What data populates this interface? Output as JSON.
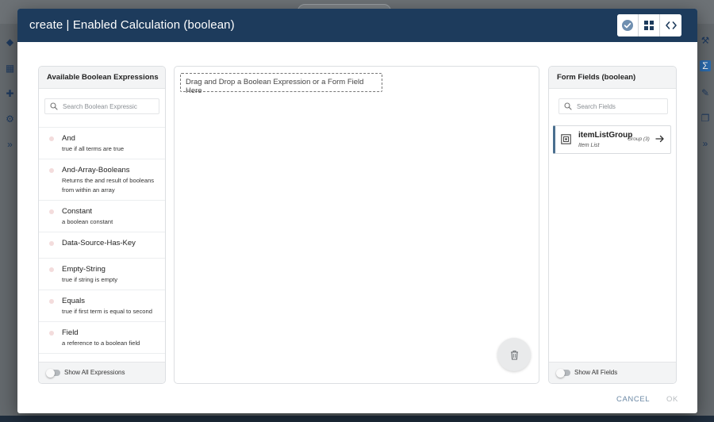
{
  "dialog": {
    "title": "create | Enabled Calculation (boolean)",
    "header_buttons": [
      "check-circle-icon",
      "grid-icon",
      "code-icon"
    ],
    "cancel_label": "CANCEL",
    "ok_label": "OK"
  },
  "left_panel": {
    "title": "Available Boolean Expressions",
    "search_placeholder": "Search Boolean Expressic",
    "expressions": [
      {
        "name": "And",
        "description": "true if all terms are true"
      },
      {
        "name": "And-Array-Booleans",
        "description": "Returns the and result of booleans from within an array"
      },
      {
        "name": "Constant",
        "description": "a boolean constant"
      },
      {
        "name": "Data-Source-Has-Key",
        "description": ""
      },
      {
        "name": "Empty-String",
        "description": "true if string is empty"
      },
      {
        "name": "Equals",
        "description": "true if first term is equal to second"
      },
      {
        "name": "Field",
        "description": "a reference to a boolean field"
      }
    ],
    "toggle_label": "Show All Expressions"
  },
  "center": {
    "drop_hint": "Drag and Drop a Boolean Expression or a Form Field Here"
  },
  "right_panel": {
    "title": "Form Fields (boolean)",
    "search_placeholder": "Search Fields",
    "fields": [
      {
        "name": "itemListGroup",
        "type": "Item List",
        "group": "Group (3)"
      }
    ],
    "toggle_label": "Show All Fields"
  },
  "colors": {
    "header_bg": "#1d3b5c",
    "field_accent": "#4a6f8f",
    "cancel_text": "#6d8aa6"
  }
}
